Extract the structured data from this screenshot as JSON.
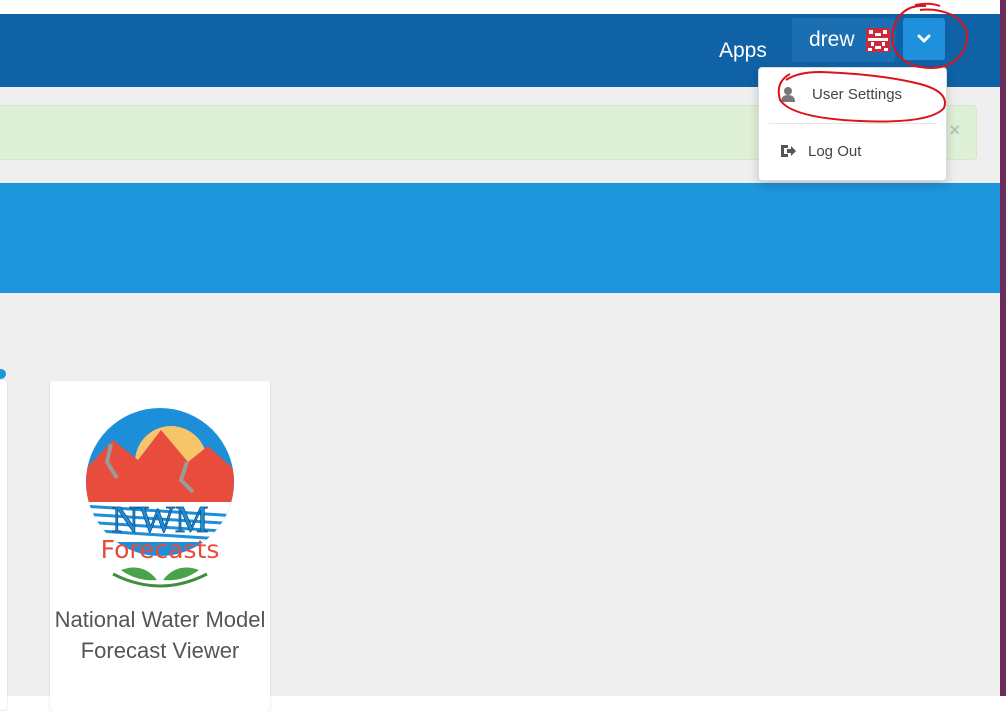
{
  "header": {
    "apps_label": "Apps",
    "username": "drew",
    "avatar_icon": "user-avatar-identicon",
    "menu_toggle_icon": "chevron-down-icon",
    "background": "#0f62a5"
  },
  "dropdown": {
    "items": [
      {
        "label": "User Settings",
        "icon": "user-icon"
      },
      {
        "label": "Log Out",
        "icon": "sign-out-icon"
      }
    ]
  },
  "alert": {
    "close_symbol": "×",
    "background": "#dff0d8"
  },
  "banner": {
    "background": "#1e96dc"
  },
  "apps": [
    {
      "logo_text_top": "NWM",
      "logo_text_bottom": "Forecasts",
      "title": "National Water Model Forecast Viewer"
    }
  ],
  "annotation_color": "#d9141c"
}
